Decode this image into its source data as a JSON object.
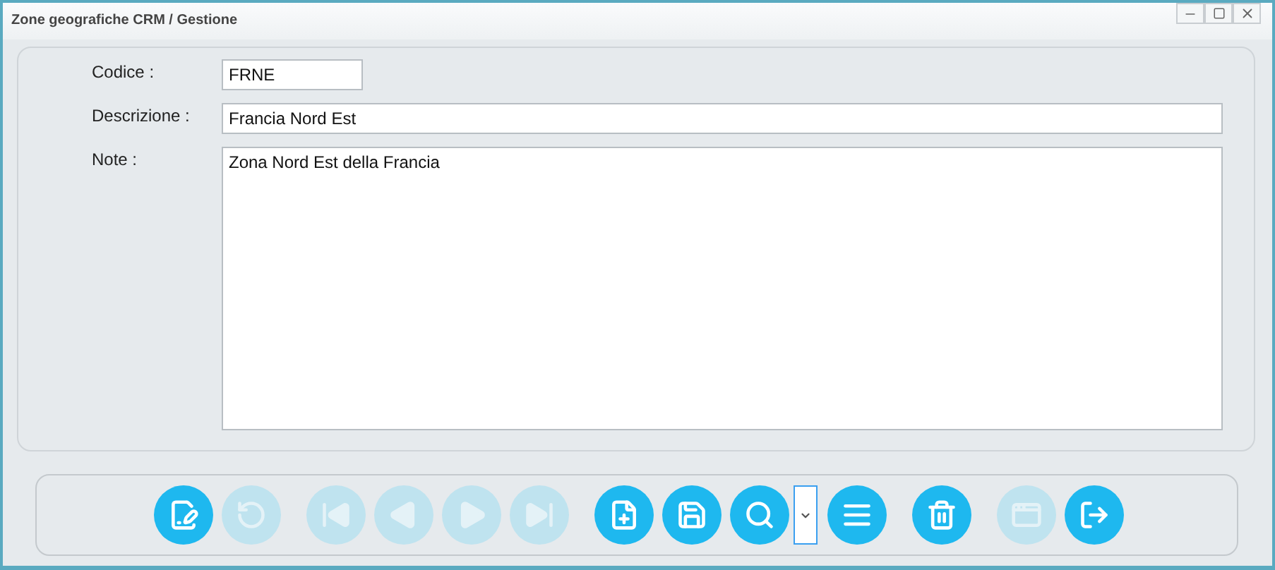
{
  "window": {
    "title": "Zone geografiche CRM / Gestione"
  },
  "form": {
    "fields": [
      {
        "label": "Codice :",
        "value": "FRNE",
        "kind": "short"
      },
      {
        "label": "Descrizione :",
        "value": "Francia Nord Est",
        "kind": "line"
      },
      {
        "label": "Note :",
        "value": "Zona Nord Est della Francia",
        "kind": "multiline"
      }
    ]
  },
  "toolbar": {
    "groups": [
      [
        {
          "kind": "edit",
          "disabled": false
        },
        {
          "kind": "undo",
          "disabled": true
        }
      ],
      [
        {
          "kind": "first",
          "disabled": true
        },
        {
          "kind": "previous",
          "disabled": true
        },
        {
          "kind": "next",
          "disabled": true
        },
        {
          "kind": "last",
          "disabled": true
        }
      ],
      [
        {
          "kind": "new",
          "disabled": false
        },
        {
          "kind": "save",
          "disabled": false
        },
        {
          "kind": "search",
          "disabled": false
        },
        {
          "kind": "dropdown",
          "disabled": false
        },
        {
          "kind": "list",
          "disabled": false
        }
      ],
      [
        {
          "kind": "delete",
          "disabled": false
        }
      ],
      [
        {
          "kind": "window",
          "disabled": true
        },
        {
          "kind": "exit",
          "disabled": false
        }
      ]
    ]
  }
}
